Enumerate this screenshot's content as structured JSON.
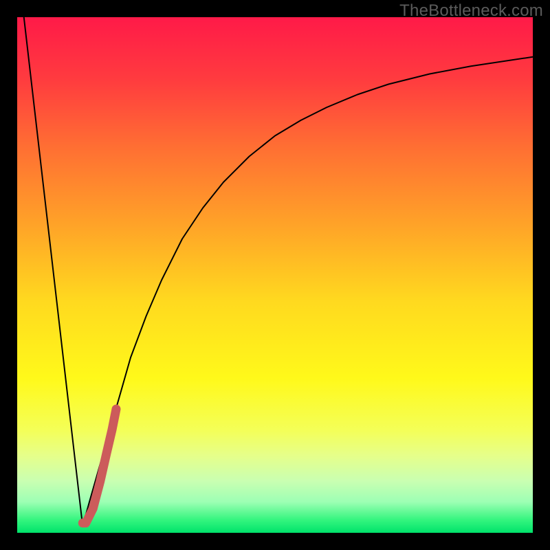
{
  "watermark": {
    "text": "TheBottleneck.com"
  },
  "chart_data": {
    "type": "line",
    "title": "",
    "xlabel": "",
    "ylabel": "",
    "xlim": [
      0,
      100
    ],
    "ylim": [
      0,
      100
    ],
    "grid": false,
    "legend": false,
    "background_gradient": {
      "stops": [
        {
          "offset": 0.0,
          "color": "#ff1a48"
        },
        {
          "offset": 0.12,
          "color": "#ff3b3f"
        },
        {
          "offset": 0.25,
          "color": "#ff6e33"
        },
        {
          "offset": 0.4,
          "color": "#ffa228"
        },
        {
          "offset": 0.55,
          "color": "#ffd91f"
        },
        {
          "offset": 0.7,
          "color": "#fff91a"
        },
        {
          "offset": 0.8,
          "color": "#f4ff57"
        },
        {
          "offset": 0.85,
          "color": "#e6ff8a"
        },
        {
          "offset": 0.9,
          "color": "#c9ffb2"
        },
        {
          "offset": 0.94,
          "color": "#9dffb4"
        },
        {
          "offset": 0.975,
          "color": "#34f57e"
        },
        {
          "offset": 1.0,
          "color": "#00e36b"
        }
      ]
    },
    "series": [
      {
        "name": "left-drop",
        "x": [
          1.3,
          12.7
        ],
        "y": [
          100,
          1.3
        ],
        "stroke": "#000000",
        "width": 2
      },
      {
        "name": "main-curve",
        "x": [
          12.7,
          14,
          16,
          18,
          20,
          22,
          25,
          28,
          32,
          36,
          40,
          45,
          50,
          55,
          60,
          66,
          72,
          80,
          88,
          100
        ],
        "y": [
          1.3,
          6,
          13,
          20,
          27,
          34,
          42,
          49,
          57,
          63,
          68,
          73,
          77,
          80,
          82.5,
          85,
          87,
          89,
          90.5,
          92.3
        ],
        "stroke": "#000000",
        "width": 2
      },
      {
        "name": "highlight-segment",
        "x": [
          12.7,
          13.3,
          14.7,
          16.1,
          17.3,
          18.4,
          19.2
        ],
        "y": [
          1.9,
          1.9,
          4.7,
          10.0,
          15.3,
          20.0,
          24.0
        ],
        "stroke": "#cc5b5b",
        "width": 13
      }
    ]
  }
}
